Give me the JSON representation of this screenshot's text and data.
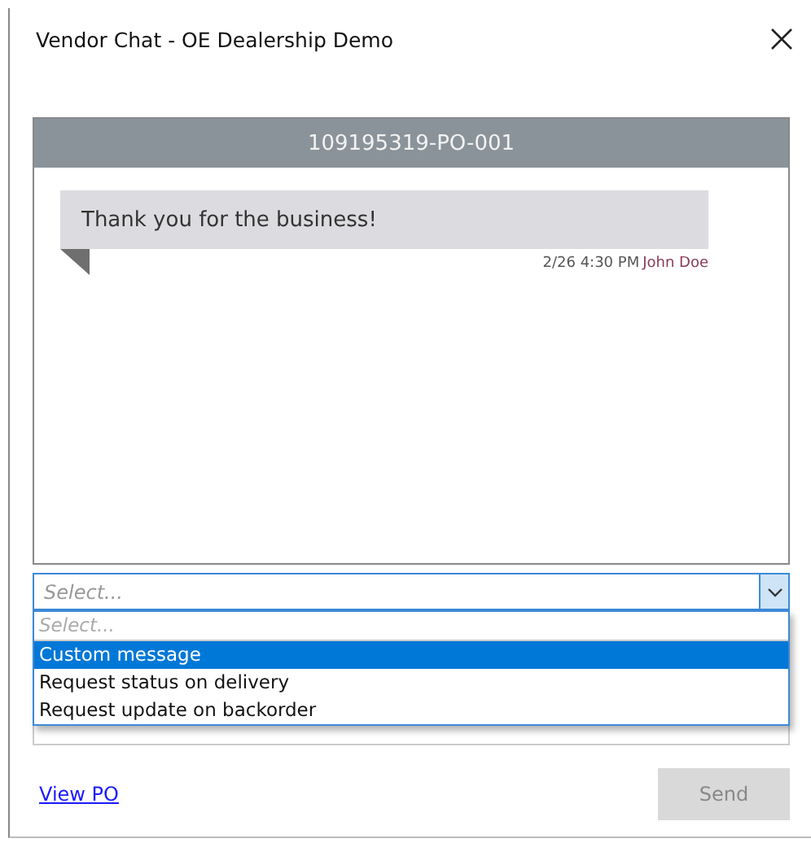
{
  "window": {
    "title": "Vendor Chat - OE Dealership Demo"
  },
  "chat": {
    "header": "109195319-PO-001",
    "messages": [
      {
        "text": "Thank you for the business!",
        "time": "2/26 4:30 PM",
        "author": "John Doe"
      }
    ]
  },
  "select": {
    "placeholder": "Select...",
    "expanded": true,
    "options": [
      {
        "label": "Select...",
        "kind": "placeholder",
        "selected": false
      },
      {
        "label": "Custom message",
        "kind": "option",
        "selected": true
      },
      {
        "label": "Request status on delivery",
        "kind": "option",
        "selected": false
      },
      {
        "label": "Request update on backorder",
        "kind": "option",
        "selected": false
      }
    ]
  },
  "footer": {
    "link": "View PO",
    "send": {
      "label": "Send",
      "disabled": true
    }
  }
}
